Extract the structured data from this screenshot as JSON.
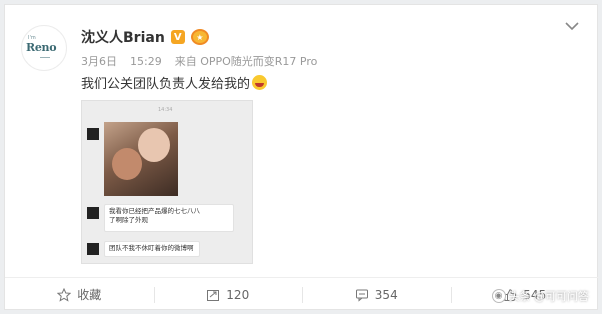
{
  "post": {
    "author": {
      "name": "沈义人Brian",
      "avatar_small_text": "I'm",
      "avatar_logo": "Reno",
      "verified_badge": "V"
    },
    "meta": {
      "date": "3月6日",
      "time": "15:29",
      "source": "来自 OPPO随光而变R17 Pro"
    },
    "text": "我们公关团队负责人发给我的"
  },
  "screenshot": {
    "timestamp": "14:34",
    "bubble1_line1": "我看你已经把产品爆的七七八八",
    "bubble1_line2": "了啊除了外观",
    "bubble2": "团队不我不休盯着你的微博啊"
  },
  "actions": {
    "favorite_label": "收藏",
    "repost_count": "120",
    "comment_count": "354",
    "like_count": "545"
  },
  "watermark": {
    "text": "头条 @可可问答"
  },
  "colors": {
    "verified": "#f5a623",
    "text": "#333333",
    "meta": "#999999"
  }
}
